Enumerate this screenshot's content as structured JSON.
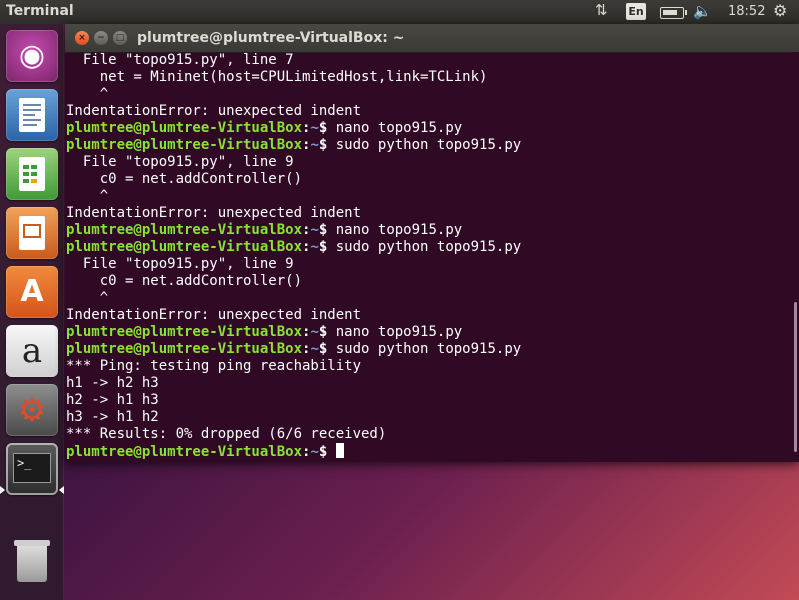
{
  "topbar": {
    "app_title": "Terminal",
    "keyboard_layout": "En",
    "clock": "18:52",
    "icons": [
      "network-icon",
      "keyboard-icon",
      "battery-icon",
      "volume-icon",
      "settings-gear-icon"
    ]
  },
  "launcher": {
    "items": [
      {
        "name": "dash-button",
        "icon": "ubuntu-logo-icon"
      },
      {
        "name": "libreoffice-writer-button",
        "icon": "writer-document-icon"
      },
      {
        "name": "libreoffice-calc-button",
        "icon": "calc-spreadsheet-icon"
      },
      {
        "name": "libreoffice-impress-button",
        "icon": "impress-presentation-icon"
      },
      {
        "name": "ubuntu-software-button",
        "icon": "software-center-icon"
      },
      {
        "name": "amazon-button",
        "icon": "amazon-icon"
      },
      {
        "name": "system-settings-button",
        "icon": "settings-tools-icon"
      },
      {
        "name": "terminal-button",
        "icon": "terminal-icon",
        "active": true
      },
      {
        "name": "trash-button",
        "icon": "trash-icon"
      }
    ],
    "terminal_glyph": ">_"
  },
  "window": {
    "title": "plumtree@plumtree-VirtualBox: ~",
    "close": "×",
    "minimize": "−",
    "maximize": "□"
  },
  "terminal": {
    "prompt": {
      "user": "plumtree@plumtree-VirtualBox",
      "sep": ":",
      "path": "~",
      "symbol": "$ "
    },
    "lines": [
      {
        "text": "  File \"topo915.py\", line 7"
      },
      {
        "text": "    net = Mininet(host=CPULimitedHost,link=TCLink)"
      },
      {
        "text": "    ^"
      },
      {
        "text": "IndentationError: unexpected indent"
      },
      {
        "prompt": true,
        "cmd": "nano topo915.py"
      },
      {
        "prompt": true,
        "cmd": "sudo python topo915.py"
      },
      {
        "text": "  File \"topo915.py\", line 9"
      },
      {
        "text": "    c0 = net.addController()"
      },
      {
        "text": "    ^"
      },
      {
        "text": "IndentationError: unexpected indent"
      },
      {
        "prompt": true,
        "cmd": "nano topo915.py"
      },
      {
        "prompt": true,
        "cmd": "sudo python topo915.py"
      },
      {
        "text": "  File \"topo915.py\", line 9"
      },
      {
        "text": "    c0 = net.addController()"
      },
      {
        "text": "    ^"
      },
      {
        "text": "IndentationError: unexpected indent"
      },
      {
        "prompt": true,
        "cmd": "nano topo915.py"
      },
      {
        "prompt": true,
        "cmd": "sudo python topo915.py"
      },
      {
        "text": "*** Ping: testing ping reachability"
      },
      {
        "text": "h1 -> h2 h3"
      },
      {
        "text": "h2 -> h1 h3"
      },
      {
        "text": "h3 -> h1 h2"
      },
      {
        "text": "*** Results: 0% dropped (6/6 received)"
      },
      {
        "prompt": true,
        "cmd": "",
        "cursor": true
      }
    ]
  }
}
